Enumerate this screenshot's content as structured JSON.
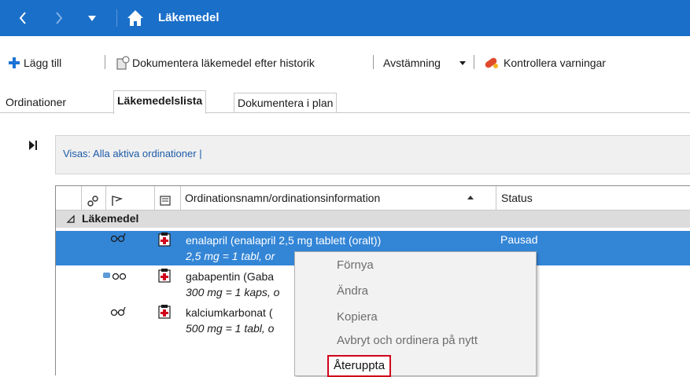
{
  "titlebar": {
    "back_icon": "chevron-left-icon",
    "forward_icon": "chevron-right-icon",
    "dropdown_icon": "caret-down-icon",
    "home_icon": "home-icon",
    "title": "Läkemedel"
  },
  "toolbar": {
    "add_label": "Lägg till",
    "document_label": "Dokumentera läkemedel efter historik",
    "reconcile_label": "Avstämning",
    "warnings_label": "Kontrollera varningar"
  },
  "tabs": [
    {
      "label": "Ordinationer"
    },
    {
      "label": "Läkemedelslista"
    },
    {
      "label": "Dokumentera i plan"
    }
  ],
  "filter": {
    "text": "Visas: Alla aktiva ordinationer  |"
  },
  "grid": {
    "headers": {
      "name": "Ordinationsnamn/ordinationsinformation",
      "status": "Status"
    },
    "group_label": "Läkemedel",
    "rows": [
      {
        "name": "enalapril (enalapril 2,5 mg tablett (oralt))",
        "info": "2,5 mg = 1 tabl, or",
        "status": "Pausad"
      },
      {
        "name": "gabapentin (Gaba",
        "info": "300 mg = 1 kaps, o",
        "status": ""
      },
      {
        "name": "kalciumkarbonat (",
        "info": "500 mg = 1 tabl, o",
        "status": ""
      }
    ]
  },
  "context_menu": {
    "items": [
      {
        "label": "Förnya"
      },
      {
        "label": "Ändra"
      },
      {
        "label": "Kopiera"
      },
      {
        "label": "Avbryt och ordinera på nytt"
      },
      {
        "label": "Återuppta"
      }
    ]
  },
  "colors": {
    "titlebar": "#1a6fc9",
    "selection": "#3385d6",
    "highlight_border": "#d0021b"
  }
}
